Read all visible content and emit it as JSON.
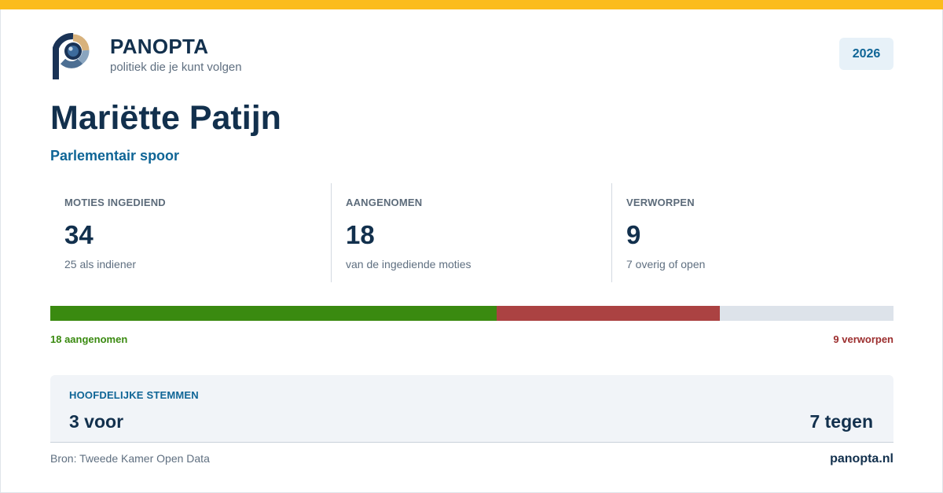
{
  "colors": {
    "accent_bar": "#fbbc1c",
    "navy": "#12304d",
    "blue": "#0f6596",
    "adopted": "#3a8a10",
    "rejected": "#ab4242",
    "remaining": "#dde3ea"
  },
  "header": {
    "logo_icon": "panopta-eye-logo",
    "brand_name": "PANOPTA",
    "tagline": "politiek die je kunt volgen",
    "year": "2026"
  },
  "person": {
    "name": "Mariëtte Patijn",
    "track": "Parlementair spoor"
  },
  "stats": [
    {
      "label": "MOTIES INGEDIEND",
      "value": "34",
      "sub": "25 als indiener"
    },
    {
      "label": "AANGENOMEN",
      "value": "18",
      "sub": "van de ingediende moties"
    },
    {
      "label": "VERWORPEN",
      "value": "9",
      "sub": "7 overig of open"
    }
  ],
  "progress": {
    "total": 34,
    "adopted": 18,
    "rejected": 9,
    "other": 7,
    "adopted_label": "18 aangenomen",
    "rejected_label": "9 verworpen"
  },
  "votes": {
    "title": "HOOFDELIJKE STEMMEN",
    "for_label": "3 voor",
    "against_label": "7 tegen"
  },
  "footer": {
    "source": "Bron: Tweede Kamer Open Data",
    "site": "panopta.nl"
  }
}
